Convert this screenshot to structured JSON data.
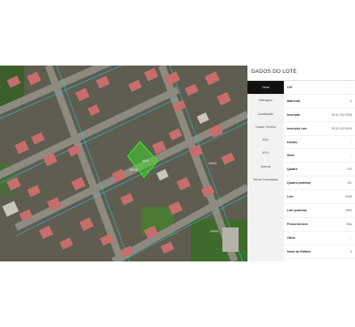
{
  "panel": {
    "title": "DADOS DO LOTE",
    "tabs": [
      {
        "label": "Geral",
        "active": true
      },
      {
        "label": "Metragem",
        "active": false
      },
      {
        "label": "Localização",
        "active": false
      },
      {
        "label": "Caract. Terreno",
        "active": false
      },
      {
        "label": "PGV",
        "active": false
      },
      {
        "label": "IPTU",
        "active": false
      },
      {
        "label": "Anexos",
        "active": false
      },
      {
        "label": "Novos Formulários",
        "active": false
      }
    ],
    "fields": [
      {
        "label": "CIG",
        "value": "-"
      },
      {
        "label": "Matrícula",
        "value": "0"
      },
      {
        "label": "Inscrição",
        "value": "09.01.122.0028"
      },
      {
        "label": "Inscrição Lote",
        "value": "09.01.122.0028"
      },
      {
        "label": "Distrito",
        "value": "-"
      },
      {
        "label": "Setor",
        "value": "-"
      },
      {
        "label": "Quadra",
        "value": "122"
      },
      {
        "label": "Quadra (cartório)",
        "value": "122"
      },
      {
        "label": "Lote",
        "value": "0028"
      },
      {
        "label": "Lote (cartório)",
        "value": "9353"
      },
      {
        "label": "Possui Anexos",
        "value": "Não"
      },
      {
        "label": "Ofício",
        "value": "-"
      },
      {
        "label": "Nome do Edifício",
        "value": "0"
      }
    ]
  },
  "map": {
    "lot_labels": [
      "09028",
      "09000",
      "09000"
    ],
    "selected_lot_label": "0028",
    "colors": {
      "highlight": "#39e61f",
      "roof": "#c76d6d",
      "street": "#8a8a80",
      "vegetation": "#3f6b2c",
      "lot_outline": "#22d4e0"
    }
  }
}
